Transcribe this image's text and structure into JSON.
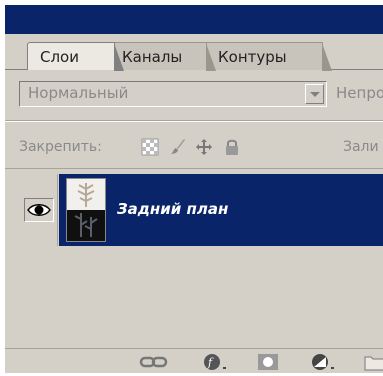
{
  "panel": {
    "tabs": [
      {
        "label": "Слои",
        "active": true
      },
      {
        "label": "Каналы",
        "active": false
      },
      {
        "label": "Контуры",
        "active": false
      }
    ],
    "blend_mode": {
      "value": "Нормальный"
    },
    "opacity_label": "Непро",
    "lock_label": "Закрепить:",
    "fill_label": "Зали",
    "lock_icons": [
      "lock-transparency-icon",
      "lock-image-brush-icon",
      "lock-position-move-icon",
      "lock-all-padlock-icon"
    ],
    "layers": [
      {
        "name": "Задний план",
        "visible": true,
        "selected": true
      }
    ],
    "bottom_icons": [
      "link-layers-icon",
      "layer-style-fx-icon",
      "layer-mask-icon",
      "adjustment-layer-icon",
      "new-group-folder-icon"
    ]
  },
  "colors": {
    "title_bar": "#0a246a",
    "selection": "#0a246a",
    "panel_bg": "#d4d0c8",
    "selected_text": "#ffffff",
    "disabled_text": "#8a8a8a"
  }
}
